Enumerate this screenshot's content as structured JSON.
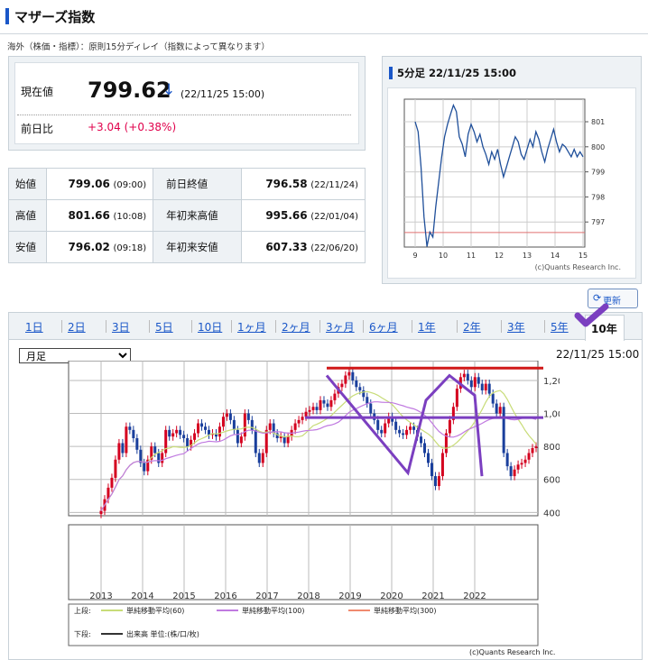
{
  "header": {
    "title": "マザーズ指数"
  },
  "notice": "海外（株価・指標）：原則15分ディレイ（指数によって異なります）",
  "quote": {
    "current_label": "現在値",
    "current_value": "799.62",
    "arrow": "↓",
    "current_time": "(22/11/25 15:00)",
    "change_label": "前日比",
    "change_value": "+3.04 (+0.38%)",
    "change_color": "#e0004b"
  },
  "ohl": [
    {
      "label": "始値",
      "value": "799.06",
      "time": "(09:00)",
      "label2": "前日終値",
      "value2": "796.58",
      "time2": "(22/11/24)"
    },
    {
      "label": "高値",
      "value": "801.66",
      "time": "(10:08)",
      "label2": "年初来高値",
      "value2": "995.66",
      "time2": "(22/01/04)"
    },
    {
      "label": "安値",
      "value": "796.02",
      "time": "(09:18)",
      "label2": "年初来安値",
      "value2": "607.33",
      "time2": "(22/06/20)"
    }
  ],
  "mini_chart": {
    "title": "5分足 22/11/25 15:00",
    "credit": "(c)Quants Research Inc."
  },
  "refresh_label": "更新",
  "tabs": [
    {
      "label": "1日"
    },
    {
      "label": "2日"
    },
    {
      "label": "3日"
    },
    {
      "label": "5日"
    },
    {
      "label": "10日"
    },
    {
      "label": "1ヶ月"
    },
    {
      "label": "2ヶ月"
    },
    {
      "label": "3ヶ月"
    },
    {
      "label": "6ヶ月"
    },
    {
      "label": "1年"
    },
    {
      "label": "2年"
    },
    {
      "label": "3年"
    },
    {
      "label": "5年"
    },
    {
      "label": "10年",
      "active": true
    }
  ],
  "period_select": {
    "selected": "月足"
  },
  "big_chart": {
    "time": "22/11/25 15:00",
    "legend_upper_label": "上段:",
    "legend_lower_label": "下段:",
    "legend_ma60": "単純移動平均(60)",
    "legend_ma100": "単純移動平均(100)",
    "legend_ma300": "単純移動平均(300)",
    "legend_volume": "出来高 単位:(株/口/枚)",
    "credit": "(c)Quants Research Inc.",
    "colors": {
      "up": "#d4001f",
      "down": "#1a3f9c",
      "ma60": "#c8dc78",
      "ma100": "#c07ae0",
      "ma300": "#f08a6e",
      "annot_red": "#d01818",
      "annot_purple": "#7b3fc0"
    }
  },
  "chart_data": [
    {
      "type": "line",
      "title": "5分足 22/11/25 15:00",
      "x_ticks": [
        "9",
        "10",
        "11",
        "12",
        "13",
        "14",
        "15"
      ],
      "y_ticks": [
        "797",
        "798",
        "799",
        "800",
        "801"
      ],
      "ylim": [
        796,
        801.9
      ],
      "reference_line": 796.58,
      "series": [
        {
          "values": [
            801.0,
            800.6,
            799.2,
            797.2,
            796.02,
            796.6,
            796.4,
            797.6,
            798.6,
            799.6,
            800.4,
            800.9,
            801.3,
            801.66,
            801.4,
            800.4,
            800.1,
            799.6,
            800.5,
            800.9,
            800.6,
            800.2,
            800.5,
            800.0,
            799.7,
            799.3,
            799.8,
            799.5,
            799.9,
            799.3,
            798.8,
            799.2,
            799.6,
            800.0,
            800.4,
            800.2,
            799.7,
            799.5,
            799.9,
            800.3,
            800.0,
            800.6,
            800.3,
            799.8,
            799.4,
            799.9,
            800.3,
            800.7,
            800.2,
            799.8,
            800.1,
            800.0,
            799.8,
            799.6,
            799.9,
            799.6,
            799.8,
            799.6
          ]
        }
      ]
    },
    {
      "type": "candlestick",
      "x_ticks": [
        "2013",
        "2014",
        "2015",
        "2016",
        "2017",
        "2018",
        "2019",
        "2020",
        "2021",
        "2022"
      ],
      "y_ticks": [
        "400",
        "600",
        "800",
        "1,000",
        "1,200"
      ],
      "ylim": [
        380,
        1320
      ],
      "series": [
        {
          "values": [
            410,
            480,
            550,
            610,
            720,
            820,
            760,
            920,
            900,
            850,
            780,
            700,
            650,
            720,
            800,
            760,
            700,
            760,
            900,
            860,
            880,
            900,
            870,
            850,
            800,
            840,
            880,
            940,
            920,
            900,
            870,
            880,
            860,
            920,
            980,
            1000,
            960,
            900,
            820,
            860,
            1000,
            960,
            900,
            760,
            700,
            760,
            900,
            940,
            880,
            850,
            860,
            820,
            860,
            900,
            940,
            960,
            980,
            1010,
            1020,
            1040,
            1020,
            1080,
            1060,
            1040,
            1080,
            1120,
            1160,
            1180,
            1230,
            1250,
            1200,
            1160,
            1140,
            1100,
            1060,
            1000,
            960,
            900,
            880,
            940,
            980,
            950,
            900,
            880,
            870,
            900,
            920,
            900,
            860,
            820,
            760,
            700,
            620,
            560,
            620,
            760,
            880,
            960,
            1040,
            1150,
            1220,
            1240,
            1200,
            1160,
            1220,
            1180,
            1140,
            1180,
            1120,
            1060,
            1000,
            1040,
            760,
            680,
            620,
            660,
            690,
            700,
            720,
            760,
            790,
            800
          ]
        }
      ]
    }
  ]
}
